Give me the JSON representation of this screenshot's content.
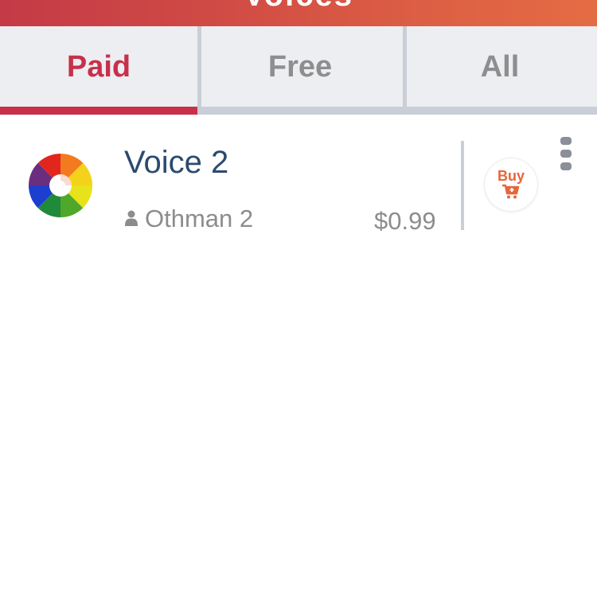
{
  "header": {
    "title": "Voices",
    "gradient_start": "#c43a46",
    "gradient_end": "#e46c43"
  },
  "tabs": [
    {
      "label": "Paid",
      "active": true
    },
    {
      "label": "Free",
      "active": false
    },
    {
      "label": "All",
      "active": false
    }
  ],
  "colors": {
    "accent": "#c8304a",
    "buy": "#e8653b",
    "title": "#2b4a6f",
    "muted": "#8c8c8c",
    "tab_bg": "#eceef2"
  },
  "items": [
    {
      "title": "Voice 2",
      "author": "Othman 2",
      "price": "$0.99",
      "buy_label": "Buy",
      "icon": "pinwheel-icon"
    }
  ]
}
